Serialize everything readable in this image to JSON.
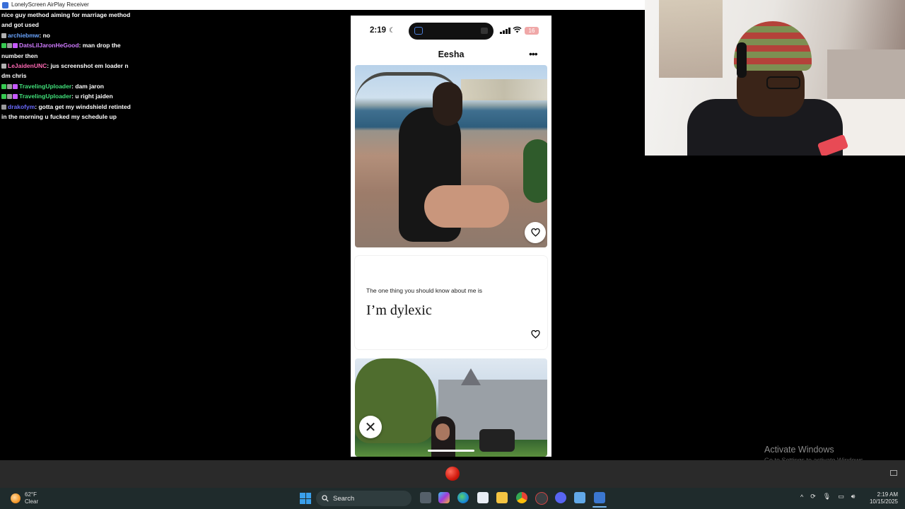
{
  "window": {
    "title": "LonelyScreen AirPlay Receiver"
  },
  "chat": {
    "messages": [
      {
        "user": "",
        "text": "nice guy method aiming for marriage method",
        "user_color": "#ffffff",
        "badges": []
      },
      {
        "user": "",
        "text": "and got used",
        "user_color": "#ffffff",
        "badges": []
      },
      {
        "user": "archiebmw",
        "text": ": no",
        "user_color": "#6aa5ff",
        "badges": [
          "#b0b0b0"
        ]
      },
      {
        "user": "DatsLilJaronHeGood",
        "text": ": man drop the",
        "user_color": "#d07bff",
        "badges": [
          "#37c851",
          "#9a9a9a",
          "#c659ff"
        ]
      },
      {
        "user": "",
        "text": "number then",
        "user_color": "#ffffff",
        "badges": []
      },
      {
        "user": "LeJaidenUNC",
        "text": ": jus screenshot em loader n",
        "user_color": "#ff69b4",
        "badges": [
          "#b0b0b0"
        ]
      },
      {
        "user": "",
        "text": "dm chris",
        "user_color": "#ffffff",
        "badges": []
      },
      {
        "user": "TravelingUploader",
        "text": ": dam jaron",
        "user_color": "#41e07a",
        "badges": [
          "#37c851",
          "#9a9a9a",
          "#c659ff"
        ]
      },
      {
        "user": "TravelingUploader",
        "text": ": u right jaiden",
        "user_color": "#41e07a",
        "badges": [
          "#37c851",
          "#9a9a9a",
          "#c659ff"
        ]
      },
      {
        "user": "drakofym",
        "text": ": gotta get my windshield retinted",
        "user_color": "#6b6bff",
        "badges": [
          "#9a9a9a"
        ]
      },
      {
        "user": "",
        "text": "in the morning u fucked my schedule up",
        "user_color": "#ffffff",
        "badges": []
      }
    ]
  },
  "phone": {
    "status_time": "2:19",
    "battery": "16",
    "profile_name": "Eesha",
    "prompt": {
      "question": "The one thing you should know about me is",
      "answer": "I’m dylexic"
    }
  },
  "overlay": {
    "activate_title": "Activate Windows",
    "activate_subtitle": "Go to Settings to activate Windows."
  },
  "taskbar": {
    "weather_temp": "62°F",
    "weather_cond": "Clear",
    "search_label": "Search",
    "time": "2:19 AM",
    "date": "10/15/2025"
  },
  "colors": {
    "taskbar_bg": "#1f2b2c",
    "record_red": "#d11a0e",
    "windows_blue": "#3a9fea"
  }
}
